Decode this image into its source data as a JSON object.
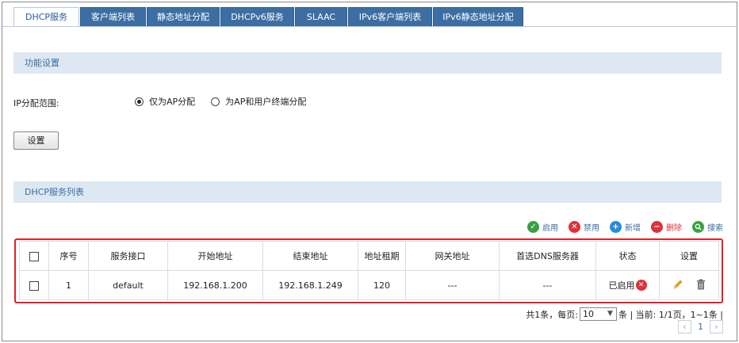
{
  "tabs": [
    {
      "label": "DHCP服务",
      "active": true
    },
    {
      "label": "客户端列表"
    },
    {
      "label": "静态地址分配"
    },
    {
      "label": "DHCPv6服务"
    },
    {
      "label": "SLAAC"
    },
    {
      "label": "IPv6客户端列表"
    },
    {
      "label": "IPv6静态地址分配"
    }
  ],
  "function_section": {
    "title": "功能设置",
    "ip_range_label": "IP分配范围:",
    "options": [
      {
        "label": "仅为AP分配",
        "checked": true
      },
      {
        "label": "为AP和用户终端分配",
        "checked": false
      }
    ],
    "save_button": "设置"
  },
  "list_section": {
    "title": "DHCP服务列表"
  },
  "toolbar": {
    "enable": "启用",
    "disable": "禁用",
    "add": "新增",
    "delete": "删除",
    "search": "搜索"
  },
  "table": {
    "headers": [
      "序号",
      "服务接口",
      "开始地址",
      "结束地址",
      "地址租期",
      "网关地址",
      "首选DNS服务器",
      "状态",
      "设置"
    ],
    "rows": [
      {
        "index": "1",
        "interface": "default",
        "start": "192.168.1.200",
        "end": "192.168.1.249",
        "lease": "120",
        "gateway": "---",
        "dns": "---",
        "status": "已启用"
      }
    ]
  },
  "pagination": {
    "summary_prefix": "共1条，每页:",
    "per_page": "10",
    "summary_suffix": "条 | 当前: 1/1页，1~1条 |",
    "current_page": "1",
    "prev": "‹",
    "next": "›"
  },
  "colors": {
    "tab_bg": "#3d6ea3",
    "section_bg": "#dde8f2",
    "highlight_border": "#e0202a",
    "enable_green": "#3aa142",
    "disable_red": "#e0303a",
    "add_blue": "#2a8ad8"
  }
}
